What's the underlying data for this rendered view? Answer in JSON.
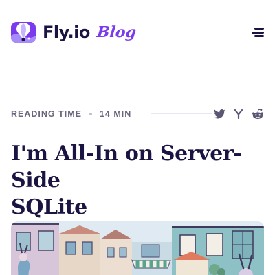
{
  "header": {
    "brand": "Fly.io",
    "section": "Blog",
    "logo_icon": "fly-balloon-logo",
    "menu_icon": "hamburger-menu-icon"
  },
  "meta": {
    "reading_label": "READING TIME",
    "reading_value": "14 MIN",
    "share": [
      {
        "name": "twitter",
        "icon": "twitter-icon"
      },
      {
        "name": "hacker-news",
        "icon": "hacker-news-icon"
      },
      {
        "name": "reddit",
        "icon": "reddit-icon"
      }
    ]
  },
  "article": {
    "title_line1": "I'm All-In on Server-Side",
    "title_line2": "SQLite",
    "hero_image": "illustrated-street-scene"
  },
  "colors": {
    "brand_ink": "#1a1442",
    "accent": "#7c3aed",
    "meta_gray": "#6b6680"
  }
}
